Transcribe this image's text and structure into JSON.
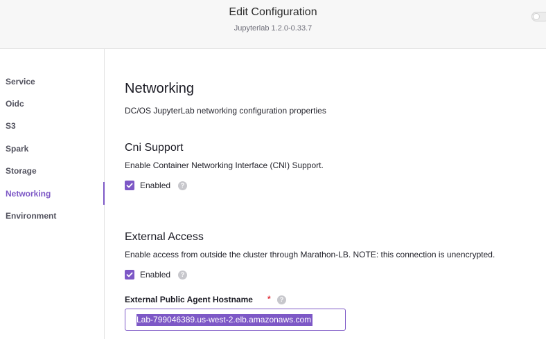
{
  "header": {
    "title": "Edit Configuration",
    "subtitle": "Jupyterlab 1.2.0-0.33.7"
  },
  "sidebar": {
    "items": [
      {
        "label": "Service"
      },
      {
        "label": "Oidc"
      },
      {
        "label": "S3"
      },
      {
        "label": "Spark"
      },
      {
        "label": "Storage"
      },
      {
        "label": "Networking",
        "active": true
      },
      {
        "label": "Environment"
      }
    ]
  },
  "main": {
    "title": "Networking",
    "description": "DC/OS JupyterLab networking configuration properties",
    "cni": {
      "heading": "Cni Support",
      "description": "Enable Container Networking Interface (CNI) Support.",
      "checkbox_label": "Enabled",
      "checked": true
    },
    "external": {
      "heading": "External Access",
      "description": "Enable access from outside the cluster through Marathon-LB. NOTE: this connection is unencrypted.",
      "checkbox_label": "Enabled",
      "checked": true,
      "hostname_label": "External Public Agent Hostname",
      "required_mark": "*",
      "hostname_value": "Lab-799046389.us-west-2.elb.amazonaws.com"
    },
    "help_glyph": "?"
  },
  "colors": {
    "accent": "#7d58c6",
    "required": "#e0323c"
  },
  "icons": {
    "help": "help-icon",
    "check": "checkmark-icon",
    "toggle": "toggle-switch"
  }
}
